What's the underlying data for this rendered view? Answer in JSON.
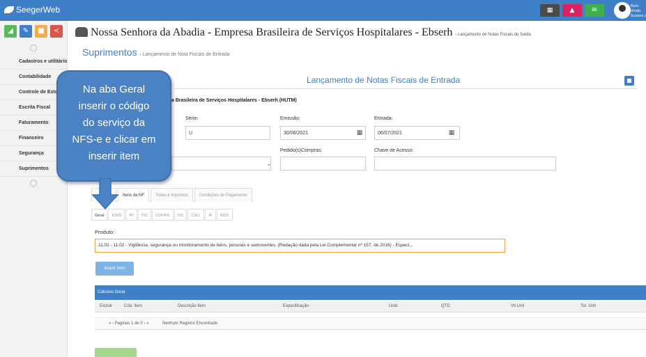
{
  "app": {
    "name": "SeegerWeb",
    "user_label": "Bem Vindo Suzano.da"
  },
  "top_icons": [
    {
      "icon": "grid-icon",
      "color": "#4a4a4a"
    },
    {
      "icon": "alert-icon",
      "color": "#d9235f"
    },
    {
      "icon": "mail-icon",
      "color": "#3fae4f"
    }
  ],
  "side_buttons": [
    {
      "icon": "chart-icon",
      "color": "#5cb85c"
    },
    {
      "icon": "pencil-icon",
      "color": "#3f7fc8"
    },
    {
      "icon": "folder-icon",
      "color": "#f0ad4e"
    },
    {
      "icon": "share-icon",
      "color": "#d9534f"
    }
  ],
  "sidebar": {
    "items": [
      {
        "label": "Cadastros e utilitário"
      },
      {
        "label": "Contabilidade"
      },
      {
        "label": "Controle de Estoque"
      },
      {
        "label": "Escrita Fiscal"
      },
      {
        "label": "Faturamento"
      },
      {
        "label": "Financeiro"
      },
      {
        "label": "Segurança"
      },
      {
        "label": "Suprimentos"
      }
    ]
  },
  "header": {
    "title": "Nossa Senhora da Abadia - Empresa Brasileira de Serviços Hospitalares - Ebserh",
    "crumb": "Lançamento de Notas Fiscais de Saída"
  },
  "breadcrumb": {
    "main": "Suprimentos",
    "sub": "› Lançamento de Nota Fiscais de Entrada"
  },
  "panel": {
    "title": "Lançamento de Notas Fiscais de Entrada",
    "company": "a Brasileira de Serviços Hospitalares - Ebserh (HUTM)"
  },
  "form": {
    "serie_label": "Série:",
    "serie_value": "U",
    "emissao_label": "Emissão:",
    "emissao_value": "30/06/2021",
    "entrada_label": "Entrada:",
    "entrada_value": "06/07/2021",
    "pedido_label": "Pedido(s)Compras:",
    "pedido_value": "",
    "chave_label": "Chave de Acesso:",
    "chave_value": ""
  },
  "tabs": [
    {
      "label": "Itens da NF"
    },
    {
      "label": "Totais e Impostos"
    },
    {
      "label": "Condições de Pagamento"
    }
  ],
  "subtabs": [
    {
      "label": "Geral"
    },
    {
      "label": "ICMS"
    },
    {
      "label": "IPI"
    },
    {
      "label": "PIS"
    },
    {
      "label": "COFINS"
    },
    {
      "label": "ISS"
    },
    {
      "label": "CSLL"
    },
    {
      "label": "IR"
    },
    {
      "label": "INSS"
    }
  ],
  "produto": {
    "label": "Produto:",
    "value": "11.02 - 11.02 - Vigilância, segurança ou monitoramento de bens, pessoas e semoventes. (Redação dada pela Lei Complementar nº 157, de 2016) - Especi..."
  },
  "insert_button": "Inserir Item",
  "grid": {
    "title": "Cálculos Geral",
    "columns": [
      "Excluir",
      "Cód. Item",
      "Descrição Item",
      "Especificação",
      "Unid.",
      "QTD",
      "Vlr.Unit",
      "Tot. Unit"
    ],
    "pager_label": "Paginas",
    "pager_page": "1",
    "pager_of": "de 0",
    "empty": "Nenhum Registro Encontrado"
  },
  "callout": {
    "lines": [
      "Na aba Geral",
      "inserir o código",
      "do serviço da",
      "NFS-e e clicar em",
      "inserir item"
    ]
  }
}
